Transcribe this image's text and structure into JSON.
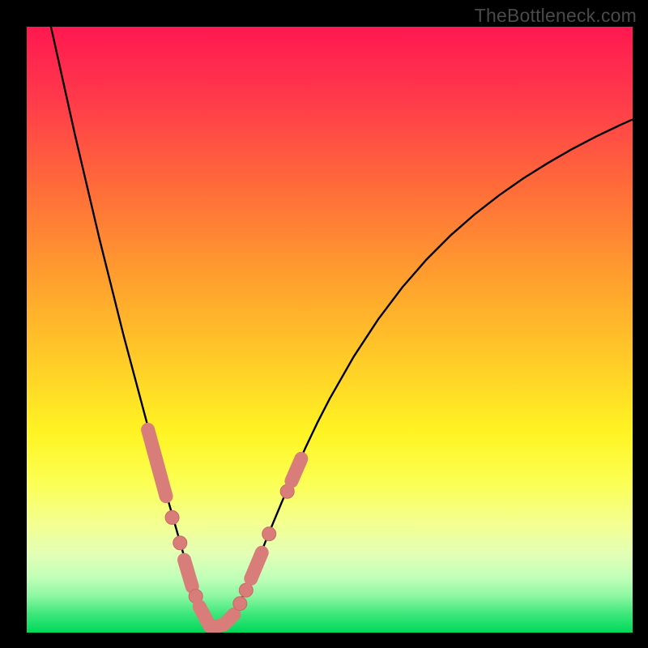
{
  "watermark": "TheBottleneck.com",
  "colors": {
    "curve_stroke": "#000000",
    "marker_fill": "#d97d7a",
    "marker_stroke": "#c96865"
  },
  "chart_data": {
    "type": "line",
    "title": "",
    "xlabel": "",
    "ylabel": "",
    "xlim": [
      0,
      100
    ],
    "ylim": [
      0,
      100
    ],
    "curve": {
      "x": [
        4,
        6,
        8,
        10,
        12,
        14,
        16,
        18,
        20,
        22,
        23,
        24,
        25,
        26,
        27,
        28,
        29,
        30,
        31,
        32,
        34,
        36,
        38,
        40,
        42,
        44,
        46,
        48,
        50,
        54,
        58,
        62,
        66,
        70,
        74,
        78,
        82,
        86,
        90,
        94,
        98,
        100
      ],
      "y": [
        100,
        91,
        82,
        73.5,
        65,
        57,
        49,
        41.5,
        34,
        26.5,
        23,
        19.5,
        16,
        12.5,
        9,
        5.8,
        3.3,
        1.6,
        0.6,
        0.6,
        2.6,
        6.7,
        11.5,
        16.5,
        21.3,
        26,
        30.5,
        34.7,
        38.6,
        45.6,
        51.7,
        57,
        61.6,
        65.6,
        69.1,
        72.2,
        75,
        77.5,
        79.8,
        81.9,
        83.8,
        84.7
      ]
    },
    "markers": [
      {
        "shape": "pill",
        "x1": 20.0,
        "y1": 33.5,
        "x2": 23.0,
        "y2": 22.5
      },
      {
        "shape": "dot",
        "x": 24.0,
        "y": 19.0
      },
      {
        "shape": "dot",
        "x": 25.3,
        "y": 14.8
      },
      {
        "shape": "pill",
        "x1": 26.0,
        "y1": 12.0,
        "x2": 27.3,
        "y2": 7.6
      },
      {
        "shape": "dot",
        "x": 27.9,
        "y": 6.0
      },
      {
        "shape": "pill",
        "x1": 28.5,
        "y1": 4.3,
        "x2": 30.2,
        "y2": 1.1
      },
      {
        "shape": "pill",
        "x1": 30.5,
        "y1": 0.8,
        "x2": 32.5,
        "y2": 1.3
      },
      {
        "shape": "pill",
        "x1": 33.0,
        "y1": 1.8,
        "x2": 34.2,
        "y2": 3.0
      },
      {
        "shape": "dot",
        "x": 35.2,
        "y": 4.8
      },
      {
        "shape": "dot",
        "x": 36.2,
        "y": 7.0
      },
      {
        "shape": "pill",
        "x1": 37.0,
        "y1": 8.9,
        "x2": 38.8,
        "y2": 13.2
      },
      {
        "shape": "dot",
        "x": 40.0,
        "y": 16.3
      },
      {
        "shape": "dot",
        "x": 43.0,
        "y": 23.3
      },
      {
        "shape": "pill",
        "x1": 43.7,
        "y1": 25.0,
        "x2": 45.3,
        "y2": 28.7
      }
    ]
  }
}
